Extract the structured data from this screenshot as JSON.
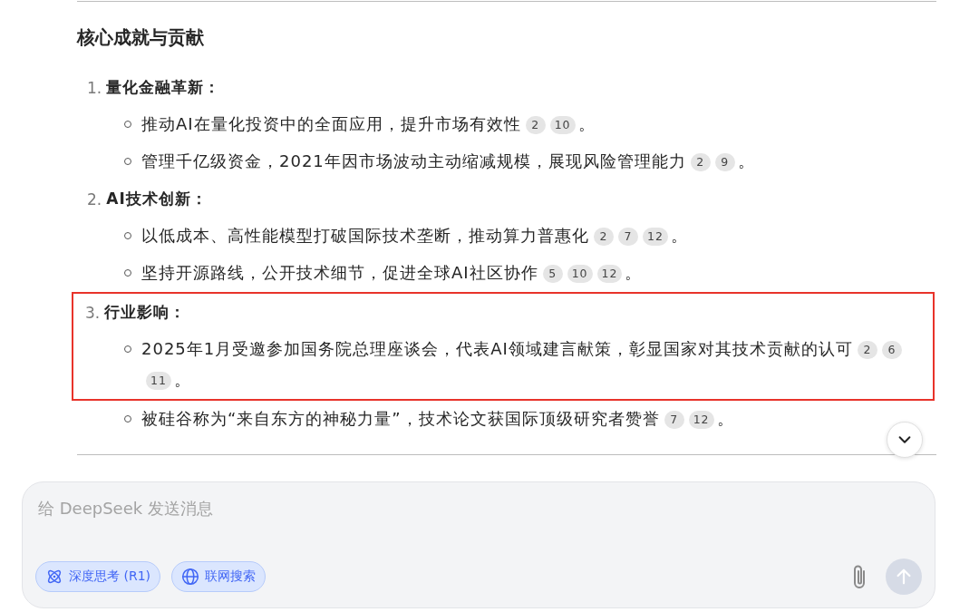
{
  "heading": "核心成就与贡献",
  "sections": [
    {
      "number": "1.",
      "title": "量化金融革新",
      "colon": "：",
      "highlighted": false,
      "points": [
        {
          "text": "推动AI在量化投资中的全面应用，提升市场有效性",
          "citations": [
            "2",
            "10"
          ],
          "end": "。",
          "highlighted": false
        },
        {
          "text": "管理千亿级资金，2021年因市场波动主动缩减规模，展现风险管理能力",
          "citations": [
            "2",
            "9"
          ],
          "end": "。",
          "highlighted": false
        }
      ]
    },
    {
      "number": "2.",
      "title": "AI技术创新",
      "colon": "：",
      "highlighted": false,
      "points": [
        {
          "text": "以低成本、高性能模型打破国际技术垄断，推动算力普惠化",
          "citations": [
            "2",
            "7",
            "12"
          ],
          "end": "。",
          "highlighted": false
        },
        {
          "text": "坚持开源路线，公开技术细节，促进全球AI社区协作",
          "citations": [
            "5",
            "10",
            "12"
          ],
          "end": "。",
          "highlighted": false
        }
      ]
    },
    {
      "number": "3.",
      "title": "行业影响",
      "colon": "：",
      "highlighted": true,
      "points": [
        {
          "text": "2025年1月受邀参加国务院总理座谈会，代表AI领域建言献策，彰显国家对其技术贡献的认可",
          "citations": [
            "2",
            "6",
            "11"
          ],
          "end": "。",
          "highlighted": true
        },
        {
          "text": "被硅谷称为“来自东方的神秘力量”，技术论文获国际顶级研究者赞誉",
          "citations": [
            "7",
            "12"
          ],
          "end": "。",
          "highlighted": false
        }
      ]
    }
  ],
  "composer": {
    "placeholder": "给 DeepSeek 发送消息",
    "toggles": [
      {
        "kind": "think",
        "label": "深度思考 (R1)",
        "selected": true
      },
      {
        "kind": "search",
        "label": "联网搜索",
        "selected": true
      }
    ],
    "send": {
      "disabled": true
    }
  }
}
